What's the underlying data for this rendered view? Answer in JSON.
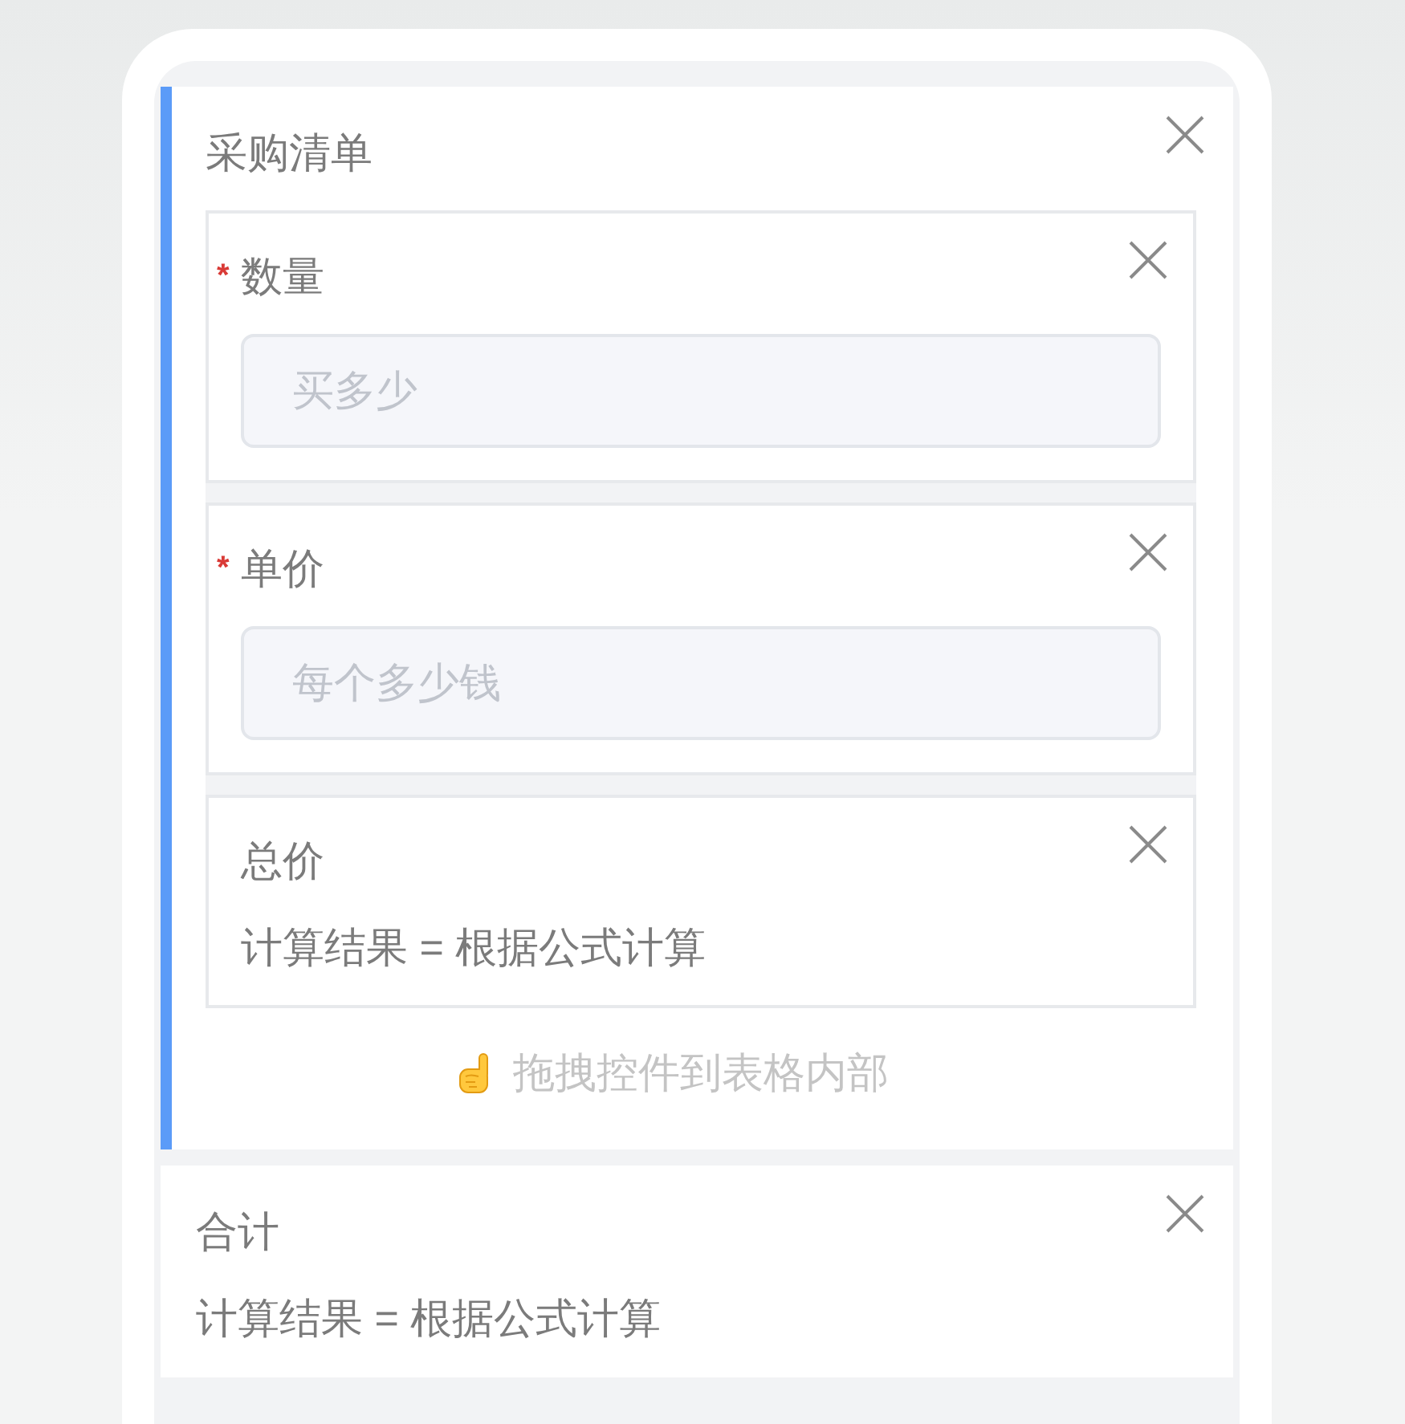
{
  "widgets": [
    {
      "kind": "table",
      "title": "采购清单",
      "selected": true,
      "fields": [
        {
          "kind": "input",
          "required_mark": "*",
          "label": "数量",
          "placeholder": "买多少",
          "selected": false
        },
        {
          "kind": "input",
          "required_mark": "*",
          "label": "单价",
          "placeholder": "每个多少钱",
          "selected": false
        },
        {
          "kind": "formula",
          "label": "总价",
          "value": "计算结果 = 根据公式计算",
          "selected": false
        }
      ],
      "drop_hint": "拖拽控件到表格内部"
    },
    {
      "kind": "formula",
      "label": "合计",
      "value": "计算结果 = 根据公式计算",
      "selected": false
    }
  ]
}
